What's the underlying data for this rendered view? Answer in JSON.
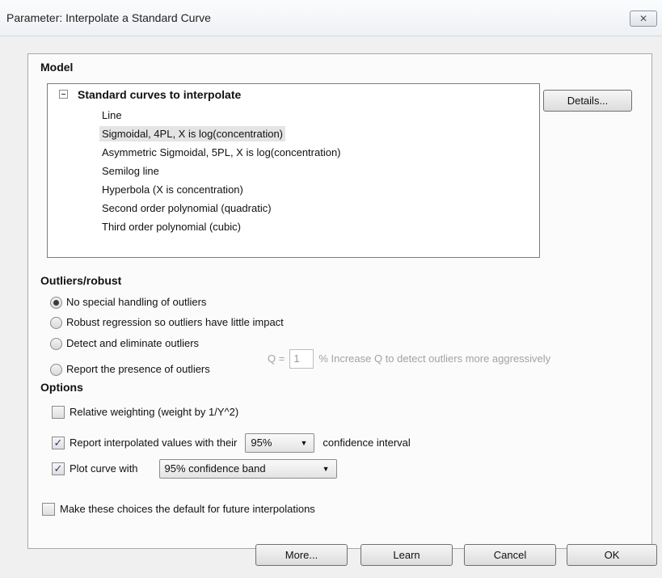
{
  "window": {
    "title": "Parameter: Interpolate a Standard Curve",
    "close_glyph": "✕"
  },
  "model": {
    "section_title": "Model",
    "tree_header": "Standard curves to interpolate",
    "items": [
      "Line",
      "Sigmoidal, 4PL, X is log(concentration)",
      "Asymmetric Sigmoidal, 5PL, X is log(concentration)",
      "Semilog line",
      "Hyperbola (X is concentration)",
      "Second order polynomial (quadratic)",
      "Third order polynomial  (cubic)"
    ],
    "selected_index": 1,
    "details_label": "Details..."
  },
  "outliers": {
    "section_title": "Outliers/robust",
    "options": [
      "No special handling of outliers",
      "Robust regression so outliers have little impact",
      "Detect and eliminate outliers",
      "Report the presence of outliers"
    ],
    "selected_index": 0,
    "q_label": "Q =",
    "q_value": "1",
    "q_hint": "% Increase Q to detect outliers more aggressively"
  },
  "options": {
    "section_title": "Options",
    "relative_weighting": {
      "label": "Relative weighting (weight by 1/Y^2)",
      "checked": false
    },
    "report_interpolated": {
      "label": "Report interpolated values with their",
      "checked": true,
      "select_value": "95%",
      "suffix": "confidence interval"
    },
    "plot_curve": {
      "label": "Plot curve with",
      "checked": true,
      "select_value": "95% confidence band"
    }
  },
  "default_choice": {
    "label": "Make these choices the default for future interpolations",
    "checked": false
  },
  "buttons": {
    "more": "More...",
    "learn": "Learn",
    "cancel": "Cancel",
    "ok": "OK"
  },
  "icons": {
    "tree_collapse": "minus-box-icon",
    "close": "close-icon",
    "dropdown": "chevron-down-icon"
  }
}
